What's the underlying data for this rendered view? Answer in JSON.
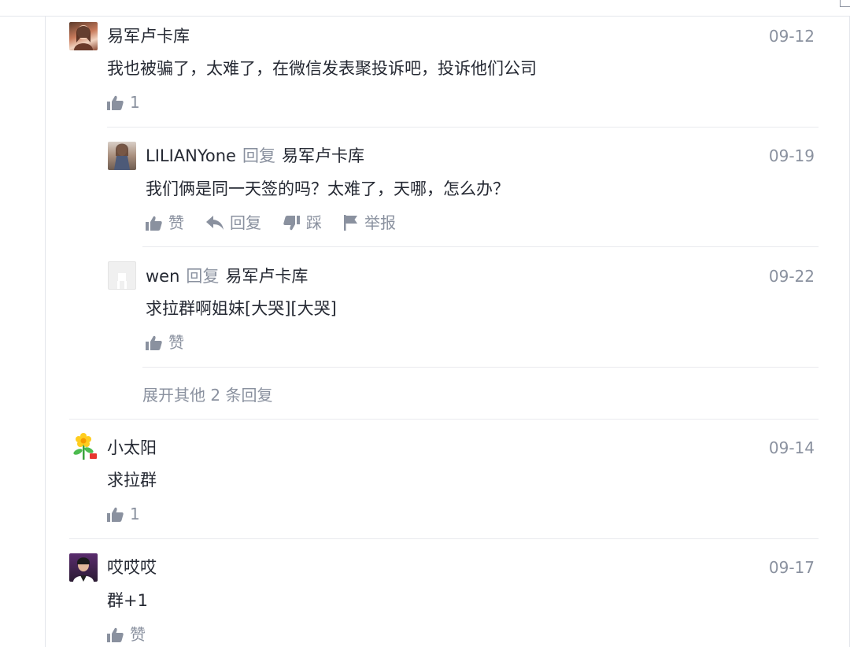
{
  "comments": [
    {
      "author": "易军卢卡库",
      "date": "09-12",
      "text": "我也被骗了，太难了，在微信发表聚投诉吧，投诉他们公司",
      "like_count": "1",
      "replies": [
        {
          "author": "LILIANYone",
          "reply_label": "回复",
          "reply_to": "易军卢卡库",
          "date": "09-19",
          "text": "我们俩是同一天签的吗？太难了，天哪，怎么办？",
          "actions": {
            "like": "赞",
            "reply": "回复",
            "dislike": "踩",
            "report": "举报"
          }
        },
        {
          "author": "wen",
          "reply_label": "回复",
          "reply_to": "易军卢卡库",
          "date": "09-22",
          "text": "求拉群啊姐妹[大哭][大哭]",
          "actions": {
            "like": "赞"
          }
        }
      ],
      "expand_label": "展开其他 2 条回复"
    },
    {
      "author": "小太阳",
      "date": "09-14",
      "text": "求拉群",
      "like_count": "1"
    },
    {
      "author": "哎哎哎",
      "date": "09-17",
      "text": "群+1",
      "like_label": "赞"
    }
  ],
  "colors": {
    "text": "#252933",
    "muted": "#8a919f",
    "divider": "#e9eaee"
  },
  "icons": [
    "thumbs-up-icon",
    "reply-arrow-icon",
    "thumbs-down-icon",
    "flag-icon"
  ]
}
